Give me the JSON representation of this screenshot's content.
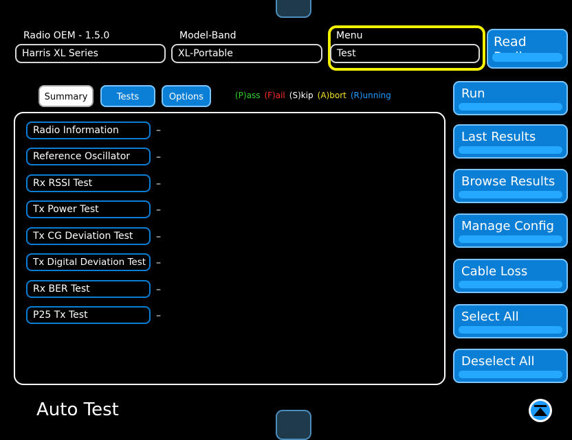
{
  "header": {
    "radio_oem": {
      "label": "Radio OEM - 1.5.0",
      "value": "Harris XL Series"
    },
    "model_band": {
      "label": "Model-Band",
      "value": "XL-Portable"
    },
    "menu": {
      "label": "Menu",
      "value": "Test"
    },
    "read_radio": "Read Radio"
  },
  "tabs": [
    {
      "label": "Summary",
      "active": true
    },
    {
      "label": "Tests",
      "active": false
    },
    {
      "label": "Options",
      "active": false
    }
  ],
  "legend": [
    {
      "text": "(P)ass",
      "color": "#31d22d"
    },
    {
      "text": "(F)ail",
      "color": "#ff2a2a"
    },
    {
      "text": "(S)kip",
      "color": "#ffffff"
    },
    {
      "text": "(A)bort",
      "color": "#f0e024"
    },
    {
      "text": "(R)unning",
      "color": "#1e9bff"
    }
  ],
  "tests": [
    {
      "label": "Radio Information",
      "status": "–"
    },
    {
      "label": "Reference Oscillator",
      "status": "–"
    },
    {
      "label": "Rx RSSI Test",
      "status": "–"
    },
    {
      "label": "Tx Power Test",
      "status": "–"
    },
    {
      "label": "Tx CG Deviation Test",
      "status": "–"
    },
    {
      "label": "Tx Digital Deviation Test",
      "status": "–"
    },
    {
      "label": "Rx BER Test",
      "status": "–"
    },
    {
      "label": "P25 Tx Test",
      "status": "–"
    }
  ],
  "side_buttons": [
    {
      "label": "Run"
    },
    {
      "label": "Last Results"
    },
    {
      "label": "Browse Results"
    },
    {
      "label": "Manage Config"
    },
    {
      "label": "Cable Loss"
    },
    {
      "label": "Select All"
    },
    {
      "label": "Deselect All"
    }
  ],
  "footer": {
    "title": "Auto Test"
  },
  "colors": {
    "accent": "#0b7fd6",
    "highlight": "#f5f000"
  }
}
